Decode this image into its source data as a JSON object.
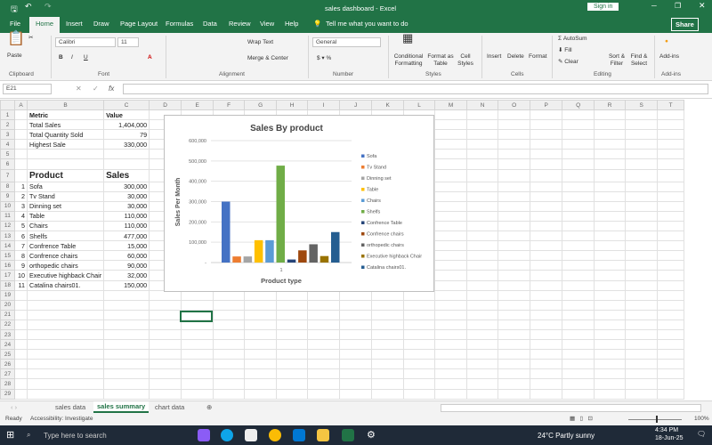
{
  "title": "sales dashboard - Excel",
  "sign_in": "Sign in",
  "share": "Share",
  "tabs": [
    "File",
    "Home",
    "Insert",
    "Draw",
    "Page Layout",
    "Formulas",
    "Data",
    "Review",
    "View",
    "Help"
  ],
  "tell_me": "Tell me what you want to do",
  "ribbon": {
    "paste": "Paste",
    "clipboard": "Clipboard",
    "font_name": "Calibri",
    "font_size": "11",
    "font": "Font",
    "wrap": "Wrap Text",
    "merge": "Merge & Center",
    "alignment": "Alignment",
    "number_format": "General",
    "number": "Number",
    "cond": "Conditional Formatting",
    "fmt_table": "Format as Table",
    "cell_styles": "Cell Styles",
    "styles": "Styles",
    "insert": "Insert",
    "delete": "Delete",
    "format": "Format",
    "cells": "Cells",
    "autosum": "AutoSum",
    "fill": "Fill",
    "clear": "Clear",
    "sort": "Sort & Filter",
    "find": "Find & Select",
    "editing": "Editing",
    "addins": "Add-ins",
    "addins_grp": "Add-ins"
  },
  "name_box": "E21",
  "fx": "fx",
  "columns": [
    "A",
    "B",
    "C",
    "D",
    "E",
    "F",
    "G",
    "H",
    "I",
    "J",
    "K",
    "L",
    "M",
    "N",
    "O",
    "P",
    "Q",
    "R",
    "S",
    "T"
  ],
  "rows": [
    {
      "b": "Metric",
      "c": "Value"
    },
    {
      "b": "Total Sales",
      "c": "1,404,000"
    },
    {
      "b": "Total Quantity Sold",
      "c": "79"
    },
    {
      "b": "Highest Sale",
      "c": "330,000"
    },
    {},
    {},
    {
      "b": "Product",
      "c": "Sales"
    },
    {
      "a": "1",
      "b": "Sofa",
      "c": "300,000"
    },
    {
      "a": "2",
      "b": "Tv Stand",
      "c": "30,000"
    },
    {
      "a": "3",
      "b": "Dinning set",
      "c": "30,000"
    },
    {
      "a": "4",
      "b": "Table",
      "c": "110,000"
    },
    {
      "a": "5",
      "b": "Chairs",
      "c": "110,000"
    },
    {
      "a": "6",
      "b": "Shelfs",
      "c": "477,000"
    },
    {
      "a": "7",
      "b": "Confrence Table",
      "c": "15,000"
    },
    {
      "a": "8",
      "b": "Confrence chairs",
      "c": "60,000"
    },
    {
      "a": "9",
      "b": "orthopedic chairs",
      "c": "90,000"
    },
    {
      "a": "10",
      "b": "Executive highback Chair",
      "c": "32,000"
    },
    {
      "a": "11",
      "b": "Catalina chairs01.",
      "c": "150,000"
    }
  ],
  "chart_data": {
    "type": "bar",
    "title": "Sales By product",
    "xlabel": "Product type",
    "ylabel": "Sales Per Month",
    "categories": [
      "1"
    ],
    "ylim": [
      0,
      600000
    ],
    "yticks": [
      "-",
      "100,000",
      "200,000",
      "300,000",
      "400,000",
      "500,000",
      "600,000"
    ],
    "legend_position": "right",
    "series": [
      {
        "name": "Sofa",
        "values": [
          300000
        ],
        "color": "#4472C4"
      },
      {
        "name": "Tv Stand",
        "values": [
          30000
        ],
        "color": "#ED7D31"
      },
      {
        "name": "Dinning set",
        "values": [
          30000
        ],
        "color": "#A5A5A5"
      },
      {
        "name": "Table",
        "values": [
          110000
        ],
        "color": "#FFC000"
      },
      {
        "name": "Chairs",
        "values": [
          110000
        ],
        "color": "#5B9BD5"
      },
      {
        "name": "Shelfs",
        "values": [
          477000
        ],
        "color": "#70AD47"
      },
      {
        "name": "Confrence Table",
        "values": [
          15000
        ],
        "color": "#264478"
      },
      {
        "name": "Confrence chairs",
        "values": [
          60000
        ],
        "color": "#9E480E"
      },
      {
        "name": "orthopedic chairs",
        "values": [
          90000
        ],
        "color": "#636363"
      },
      {
        "name": "Executive highback Chair",
        "values": [
          32000
        ],
        "color": "#997300"
      },
      {
        "name": "Catalina chairs01.",
        "values": [
          150000
        ],
        "color": "#255E91"
      }
    ]
  },
  "sheets": [
    "sales data",
    "sales summary",
    "chart data"
  ],
  "status": {
    "ready": "Ready",
    "accessibility": "Accessibility: Investigate",
    "zoom": "100%"
  },
  "taskbar": {
    "search": "Type here to search",
    "weather": "24°C  Partly sunny",
    "time": "4:34 PM",
    "date": "18-Jun-25"
  }
}
